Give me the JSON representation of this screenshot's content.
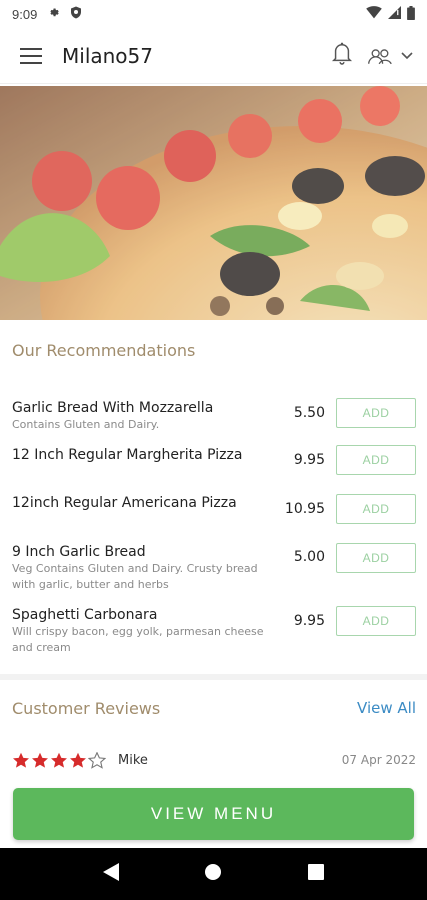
{
  "status_bar": {
    "time": "9:09"
  },
  "app_bar": {
    "title": "Milano57"
  },
  "recommendations": {
    "title": "Our Recommendations",
    "add_label": "ADD",
    "items": [
      {
        "name": "Garlic Bread With Mozzarella",
        "description": "Contains Gluten and Dairy.",
        "price": "5.50"
      },
      {
        "name": "12 Inch Regular Margherita Pizza",
        "description": "",
        "price": "9.95"
      },
      {
        "name": "12inch Regular Americana Pizza",
        "description": "",
        "price": "10.95"
      },
      {
        "name": "9 Inch Garlic Bread",
        "description": "Veg Contains Gluten and Dairy. Crusty bread with garlic, butter and herbs",
        "price": "5.00"
      },
      {
        "name": "Spaghetti Carbonara",
        "description": "Will crispy bacon, egg yolk, parmesan cheese and cream",
        "price": "9.95"
      }
    ]
  },
  "reviews": {
    "title": "Customer Reviews",
    "view_all": "View All",
    "items": [
      {
        "rating": 4,
        "max_rating": 5,
        "author": "Mike",
        "date": "07 Apr 2022"
      }
    ]
  },
  "view_menu_label": "VIEW MENU",
  "colors": {
    "accent_green": "#5cb85c",
    "section_title": "#a08c6c",
    "link_blue": "#3b8bc4",
    "star_red": "#d62b2b"
  }
}
